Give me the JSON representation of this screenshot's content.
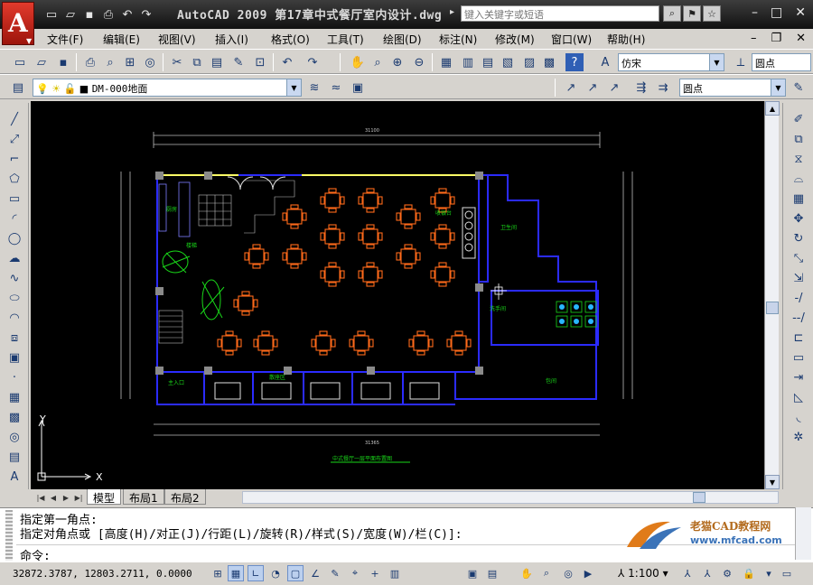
{
  "title": {
    "text": "AutoCAD 2009  第17章中式餐厅室内设计.dwg",
    "search_placeholder": "键入关键字或短语"
  },
  "menu": [
    "文件(F)",
    "编辑(E)",
    "视图(V)",
    "插入(I)",
    "格式(O)",
    "工具(T)",
    "绘图(D)",
    "标注(N)",
    "修改(M)",
    "窗口(W)",
    "帮助(H)"
  ],
  "toolbar": {
    "text_style": "仿宋",
    "dim_style": "圆点",
    "layer": "DM-000地面",
    "multileader_style": "圆点"
  },
  "tabs": [
    "模型",
    "布局1",
    "布局2"
  ],
  "ucs": {
    "x": "X",
    "y": "Y"
  },
  "drawing": {
    "title_text": "中式餐厅一层平面布置图",
    "dims_top_total": "31100",
    "dims_bottom_total": "31365",
    "labels": [
      "厨房",
      "收银台",
      "包间",
      "卫生间",
      "洗手间",
      "楼梯",
      "散座区",
      "主入口"
    ]
  },
  "command": {
    "line1": "指定第一角点:",
    "line2": "指定对角点或 [高度(H)/对正(J)/行距(L)/旋转(R)/样式(S)/宽度(W)/栏(C)]:",
    "prompt": "命令:"
  },
  "watermark": {
    "title": "老猫CAD教程网",
    "url": "www.mfcad.com"
  },
  "status": {
    "coords": "32872.3787, 12803.2711, 0.0000",
    "scale": "1:100"
  },
  "colors": {
    "canvas": "#000000",
    "wall": "#1a1aff",
    "furniture": "#ff6a1a",
    "dim": "#c8c8c8",
    "green": "#19d719",
    "yellow": "#ffff66"
  }
}
